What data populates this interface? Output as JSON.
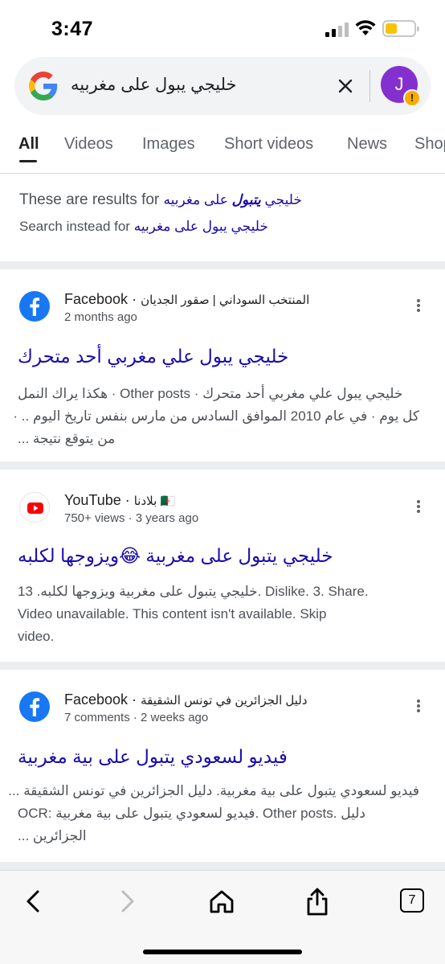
{
  "status_bar": {
    "time": "3:47"
  },
  "search": {
    "query": "خليجي يبول على مغربيه"
  },
  "avatar": {
    "initial": "J",
    "badge": "!"
  },
  "tabs": [
    {
      "label": "All"
    },
    {
      "label": "Videos"
    },
    {
      "label": "Images"
    },
    {
      "label": "Short videos"
    },
    {
      "label": "News"
    },
    {
      "label": "Shop"
    }
  ],
  "spelling": {
    "results_prefix": "These are results for",
    "corrected_query_before": "خليجي ",
    "corrected_query_bold": "يتبول",
    "corrected_query_after": " على مغربيه",
    "instead_prefix": "Search instead for",
    "original_query": "خليجي يبول على مغربيه"
  },
  "results": [
    {
      "source": "Facebook",
      "path": "المنتخب السوداني | صقور الجديان",
      "meta": "2 months ago",
      "title": "خليجي يبول علي مغربي أحد متحرك",
      "snippet_lines": [
        "خليجي يبول علي مغربي أحد متحرك · Other posts · هكذا يراك النمل",
        "كل يوم · في عام 2010 الموافق السادس من مارس بنفس تاريخ اليوم .. ·",
        "من يتوقع نتيجة ..."
      ]
    },
    {
      "source": "YouTube",
      "path": "🇩🇿 بلادنا",
      "meta": "750+ views · 3 years ago",
      "title": "خليجي يتبول على مغربية 😂ويزوجها لكلبه",
      "snippet_lines": [
        "13 .خليجي يتبول على مغربية ويزوجها لكلبه. Dislike. 3. Share.",
        "Video unavailable. This content isn't available. Skip",
        "video."
      ]
    },
    {
      "source": "Facebook",
      "path": "دليل الجزائرين في تونس الشقيقة",
      "meta": "7 comments · 2 weeks ago",
      "title": "فيديو لسعودي يتبول على بية مغربية",
      "snippet_lines": [
        "فيديو لسعودي يتبول على بية مغربية. دليل الجزائرين في تونس الشقيقة ...",
        "OCR: فيديو لسعودي يتبول على بية مغربية. Other posts. دليل",
        "الجزائرين ..."
      ]
    }
  ],
  "bottom_bar": {
    "tab_count": "7"
  },
  "colors": {
    "link": "#1a0dab",
    "snippet": "#4d5156",
    "avatar": "#8430ce",
    "facebook": "#1877f2",
    "youtube": "#ff0000"
  }
}
